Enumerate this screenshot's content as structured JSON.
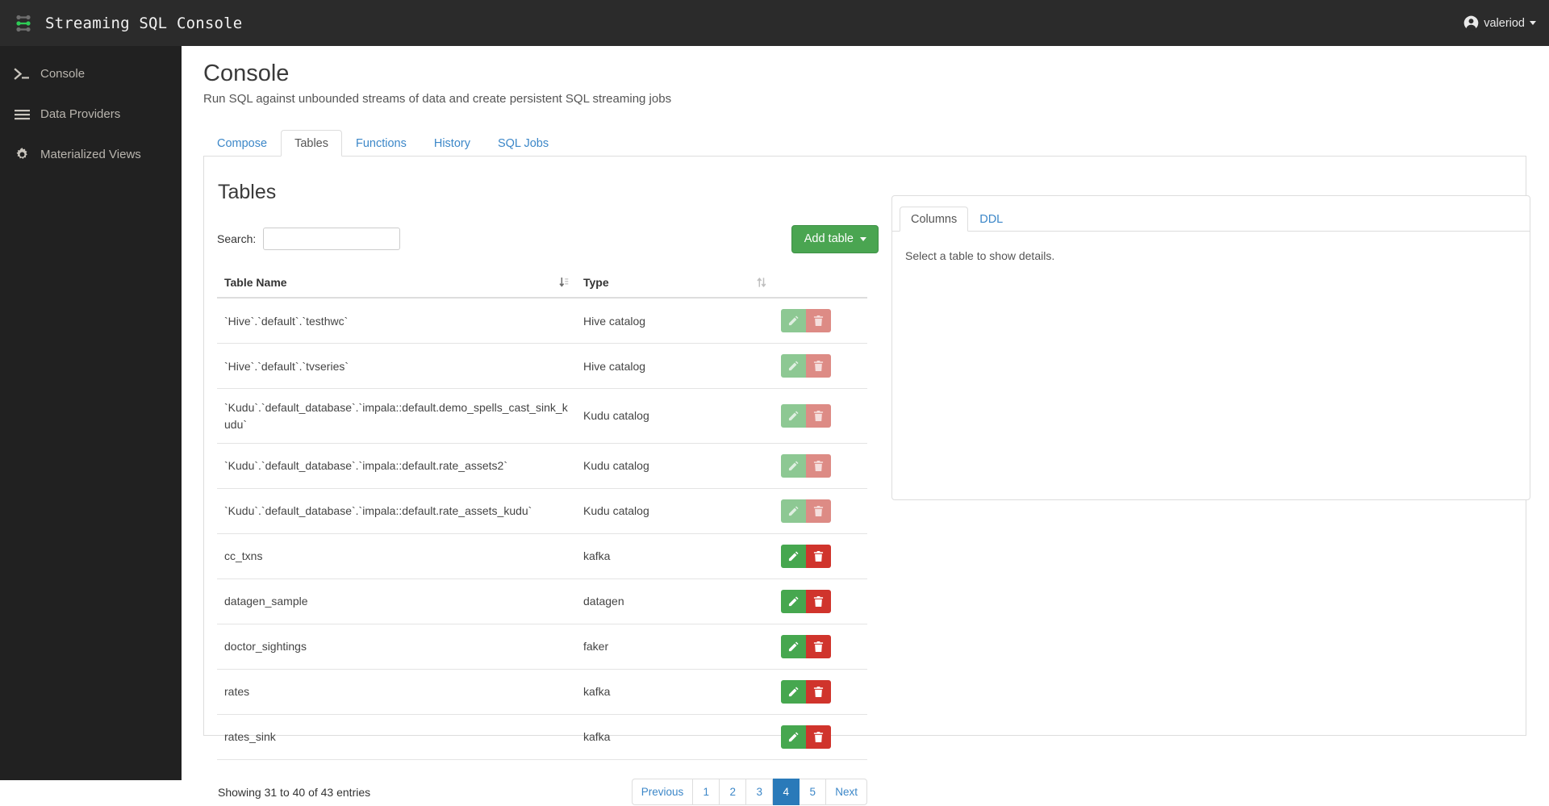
{
  "navbar": {
    "logo_icon": "graph-nodes-icon",
    "brand_title": "Streaming SQL Console",
    "user": {
      "icon": "user-circle-icon",
      "name": "valeriod"
    }
  },
  "sidebar": {
    "items": [
      {
        "label": "Console",
        "icon": "terminal-icon"
      },
      {
        "label": "Data Providers",
        "icon": "bars-icon"
      },
      {
        "label": "Materialized Views",
        "icon": "gear-icon"
      }
    ]
  },
  "page": {
    "title": "Console",
    "subtitle": "Run SQL against unbounded streams of data and create persistent SQL streaming jobs"
  },
  "tabs": [
    {
      "label": "Compose",
      "active": false
    },
    {
      "label": "Tables",
      "active": true
    },
    {
      "label": "Functions",
      "active": false
    },
    {
      "label": "History",
      "active": false
    },
    {
      "label": "SQL Jobs",
      "active": false
    }
  ],
  "tables_section": {
    "heading": "Tables",
    "search": {
      "label": "Search:",
      "value": "",
      "placeholder": ""
    },
    "add_button": {
      "label": "Add table",
      "caret": "caret-down-icon"
    },
    "columns": [
      {
        "header": "Table Name",
        "sort_icon": "sort-desc-icon"
      },
      {
        "header": "Type",
        "sort_icon": "sort-neutral-icon"
      },
      {
        "header": "",
        "sort_icon": ""
      }
    ],
    "rows": [
      {
        "name": "`Hive`.`default`.`testhwc`",
        "type": "Hive catalog",
        "actions_dim": true
      },
      {
        "name": "`Hive`.`default`.`tvseries`",
        "type": "Hive catalog",
        "actions_dim": true
      },
      {
        "name": "`Kudu`.`default_database`.`impala::default.demo_spells_cast_sink_kudu`",
        "type": "Kudu catalog",
        "actions_dim": true
      },
      {
        "name": "`Kudu`.`default_database`.`impala::default.rate_assets2`",
        "type": "Kudu catalog",
        "actions_dim": true
      },
      {
        "name": "`Kudu`.`default_database`.`impala::default.rate_assets_kudu`",
        "type": "Kudu catalog",
        "actions_dim": true
      },
      {
        "name": "cc_txns",
        "type": "kafka",
        "actions_dim": false
      },
      {
        "name": "datagen_sample",
        "type": "datagen",
        "actions_dim": false
      },
      {
        "name": "doctor_sightings",
        "type": "faker",
        "actions_dim": false
      },
      {
        "name": "rates",
        "type": "kafka",
        "actions_dim": false
      },
      {
        "name": "rates_sink",
        "type": "kafka",
        "actions_dim": false
      }
    ],
    "row_actions": {
      "edit_icon": "pencil-icon",
      "delete_icon": "trash-icon"
    },
    "footer": {
      "showing": "Showing 31 to 40 of 43 entries",
      "pagination": {
        "previous": "Previous",
        "next": "Next",
        "pages": [
          "1",
          "2",
          "3",
          "4",
          "5"
        ],
        "active_page": "4"
      }
    }
  },
  "details_panel": {
    "tabs": [
      {
        "label": "Columns",
        "active": true
      },
      {
        "label": "DDL",
        "active": false
      }
    ],
    "empty_message": "Select a table to show details."
  },
  "colors": {
    "navbar_bg": "#2b2b2b",
    "sidebar_bg": "#212121",
    "accent_link": "#3c87c8",
    "success_green": "#46a74f",
    "danger_red": "#d0342c",
    "pagination_active": "#2a7ab9",
    "logo_green": "#4caf50"
  }
}
